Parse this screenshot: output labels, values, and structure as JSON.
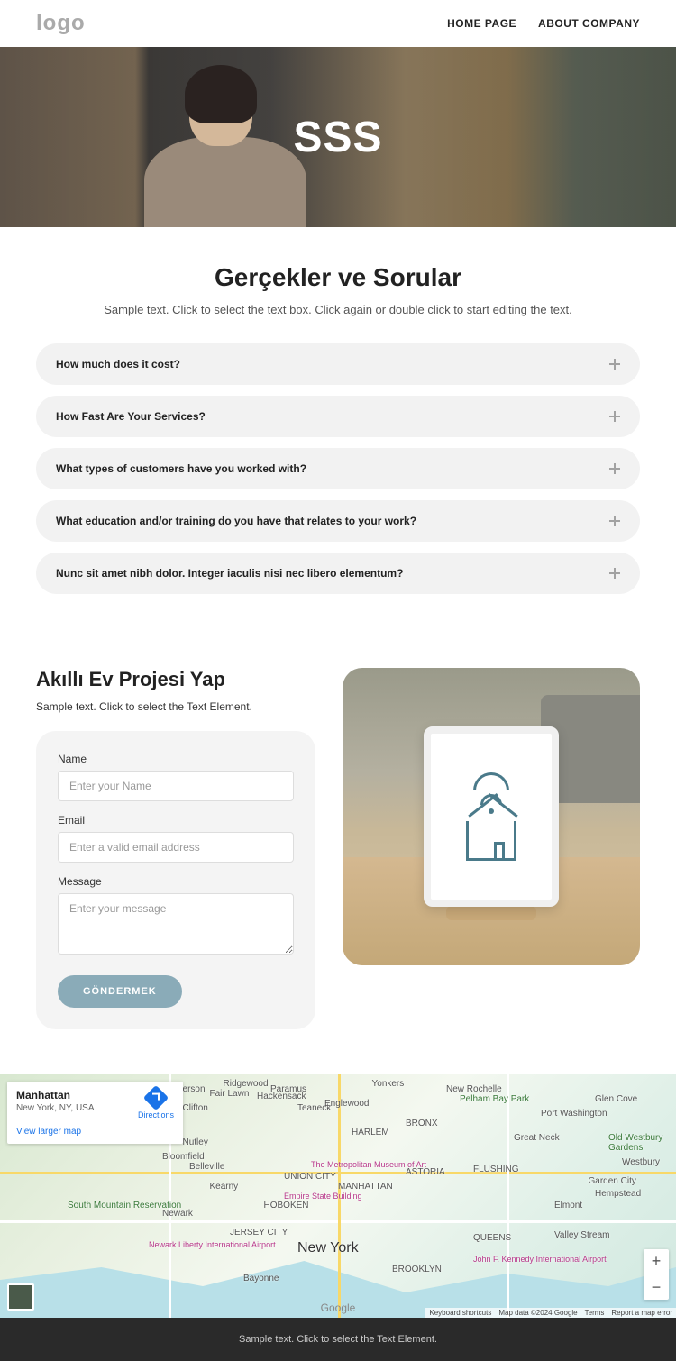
{
  "header": {
    "logo": "logo",
    "nav": [
      "HOME PAGE",
      "ABOUT COMPANY"
    ]
  },
  "hero": {
    "title": "SSS"
  },
  "faq": {
    "title": "Gerçekler ve Sorular",
    "subtitle": "Sample text. Click to select the text box. Click again or double click to start editing the text.",
    "items": [
      "How much does it cost?",
      "How Fast Are Your Services?",
      "What types of customers have you worked with?",
      "What education and/or training do you have that relates to your work?",
      "Nunc sit amet nibh dolor. Integer iaculis nisi nec libero elementum?"
    ]
  },
  "project": {
    "title": "Akıllı Ev Projesi Yap",
    "subtitle": "Sample text. Click to select the Text Element.",
    "form": {
      "name_label": "Name",
      "name_placeholder": "Enter your Name",
      "email_label": "Email",
      "email_placeholder": "Enter a valid email address",
      "message_label": "Message",
      "message_placeholder": "Enter your message",
      "submit": "GÖNDERMEK"
    }
  },
  "map": {
    "info": {
      "title": "Manhattan",
      "address": "New York, NY, USA",
      "larger": "View larger map",
      "directions": "Directions"
    },
    "labels": {
      "newyork": "New York",
      "manhattan": "MANHATTAN",
      "brooklyn": "BROOKLYN",
      "queens": "QUEENS",
      "jersey": "JERSEY CITY",
      "newark": "Newark",
      "hoboken": "HOBOKEN",
      "harlem": "HARLEM",
      "bronx": "BRONX",
      "clifton": "Clifton",
      "paterson": "Paterson",
      "hackensack": "Hackensack",
      "yonkers": "Yonkers",
      "newrochelle": "New Rochelle",
      "hempstead": "Hempstead",
      "gardencity": "Garden City",
      "westbury": "Westbury",
      "oldwestbury": "Old Westbury Gardens",
      "glencove": "Glen Cove",
      "portwash": "Port Washington",
      "greatneck": "Great Neck",
      "flushing": "FLUSHING",
      "astoria": "ASTORIA",
      "elmont": "Elmont",
      "valleystream": "Valley Stream",
      "nutley": "Nutley",
      "bloomfield": "Bloomfield",
      "belleville": "Belleville",
      "kearny": "Kearny",
      "teaneck": "Teaneck",
      "englewood": "Englewood",
      "ridgewood": "Ridgewood",
      "paramus": "Paramus",
      "fairlawn": "Fair Lawn",
      "union": "UNION CITY",
      "bayonne": "Bayonne",
      "southmtn": "South Mountain Reservation",
      "newarkair": "Newark Liberty International Airport",
      "jfk": "John F. Kennedy International Airport",
      "met": "The Metropolitan Museum of Art",
      "empire": "Empire State Building",
      "pelham": "Pelham Bay Park",
      "google": "Google"
    },
    "attribution": {
      "shortcuts": "Keyboard shortcuts",
      "data": "Map data ©2024 Google",
      "terms": "Terms",
      "report": "Report a map error"
    }
  },
  "footer": {
    "text": "Sample text. Click to select the Text Element."
  }
}
